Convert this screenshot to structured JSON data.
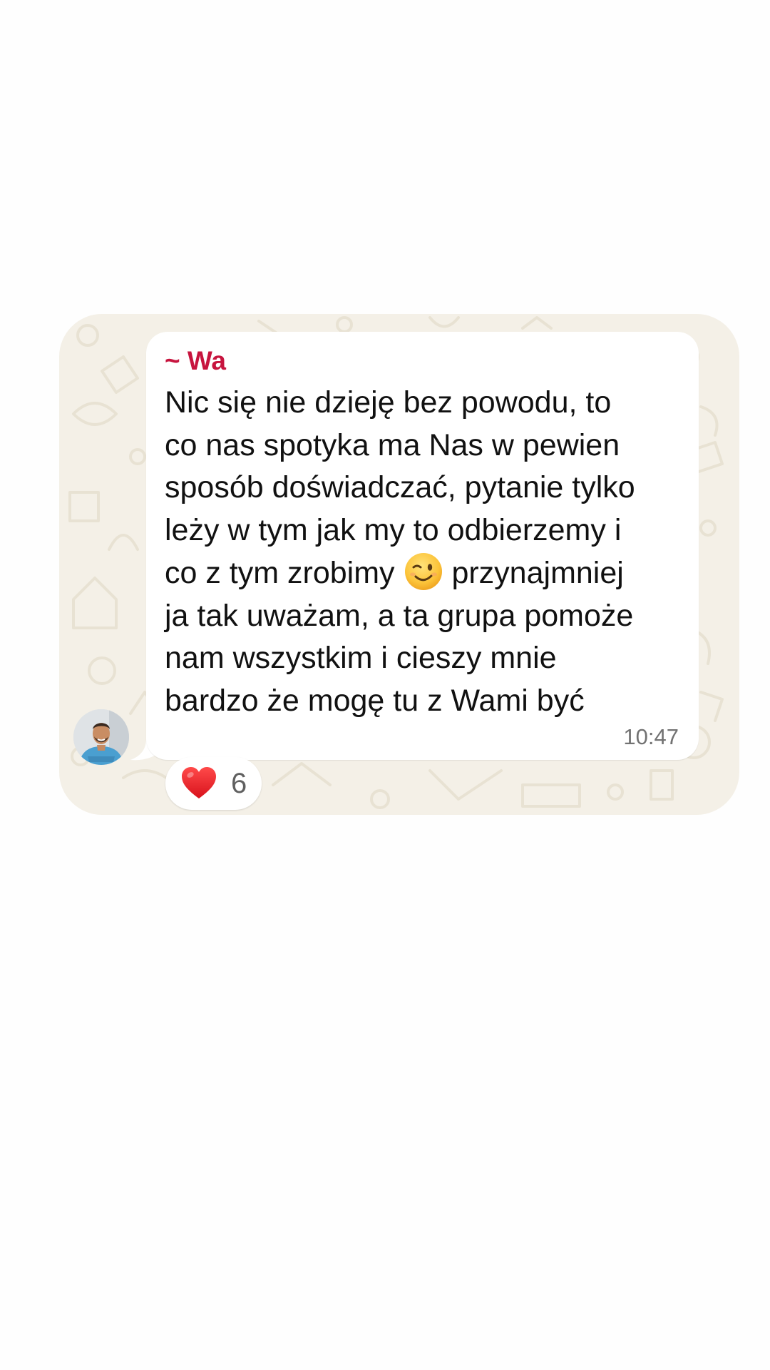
{
  "message": {
    "sender": "~ Wa",
    "text_lines": {
      "l1": "Nic się nie dzieję bez powodu, to",
      "l2": "co nas spotyka ma Nas w pewien",
      "l3": "sposób doświadczać, pytanie tylko",
      "l4": "leży w tym jak my to odbierzemy i",
      "l5_before": "co z tym zrobimy ",
      "l5_after": " przynajmniej",
      "l6": "ja tak uważam, a ta grupa pomoże",
      "l7": "nam wszystkim i cieszy mnie",
      "l8": "bardzo że mogę tu z Wami być"
    },
    "inline_emoji": "winking-face-icon",
    "time": "10:47"
  },
  "reaction": {
    "emoji": "red-heart-icon",
    "count": "6"
  },
  "colors": {
    "sender_name": "#c7143e",
    "wallpaper": "#f4f0e7",
    "bubble": "#ffffff",
    "time": "#727272"
  }
}
